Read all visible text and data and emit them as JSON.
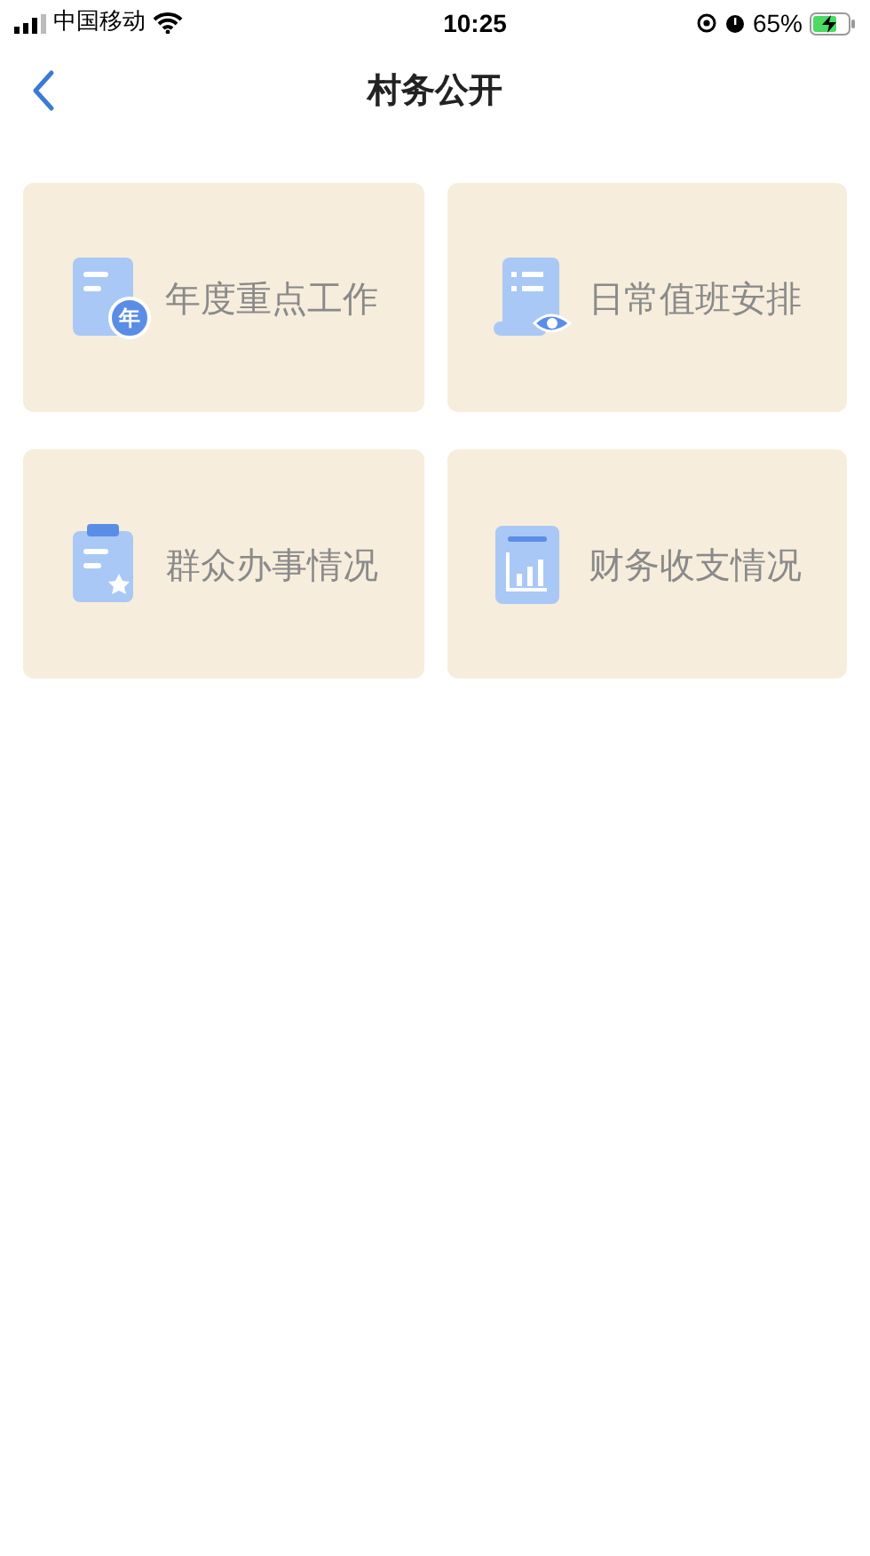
{
  "status_bar": {
    "carrier": "中国移动",
    "time": "10:25",
    "battery": "65%"
  },
  "header": {
    "title": "村务公开"
  },
  "cards": [
    {
      "label": "年度重点工作",
      "kind": "annual",
      "badge": "年"
    },
    {
      "label": "日常值班安排",
      "kind": "duty"
    },
    {
      "label": "群众办事情况",
      "kind": "service"
    },
    {
      "label": "财务收支情况",
      "kind": "finance"
    }
  ]
}
